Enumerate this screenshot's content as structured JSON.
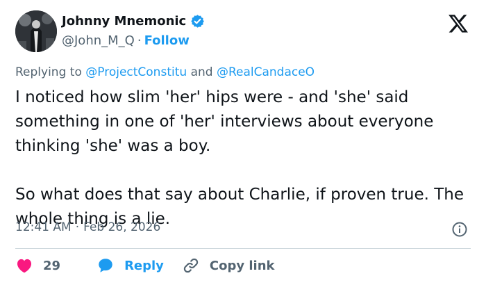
{
  "author": {
    "name": "Johnny Mnemonic",
    "handle": "@John_M_Q",
    "separator": "·",
    "follow_label": "Follow"
  },
  "platform_icon": "x-logo-icon",
  "replying": {
    "prefix": "Replying to",
    "mention_1": "@ProjectConstitu",
    "conjunction": "and",
    "mention_2": "@RealCandaceO"
  },
  "post_text": "I noticed how slim 'her' hips were - and 'she' said something in one of 'her' interviews about everyone thinking 'she' was a boy.\n\nSo what does that say about Charlie, if proven true. The whole thing is a lie.",
  "meta": {
    "time": "12:41 AM",
    "separator": "·",
    "date": "Feb 26, 2026"
  },
  "actions": {
    "likes_count": "29",
    "reply_label": "Reply",
    "copy_link_label": "Copy link"
  },
  "colors": {
    "accent": "#1d9bf0",
    "like": "#f91880",
    "secondary_text": "#536471",
    "divider": "#cfd9de"
  }
}
